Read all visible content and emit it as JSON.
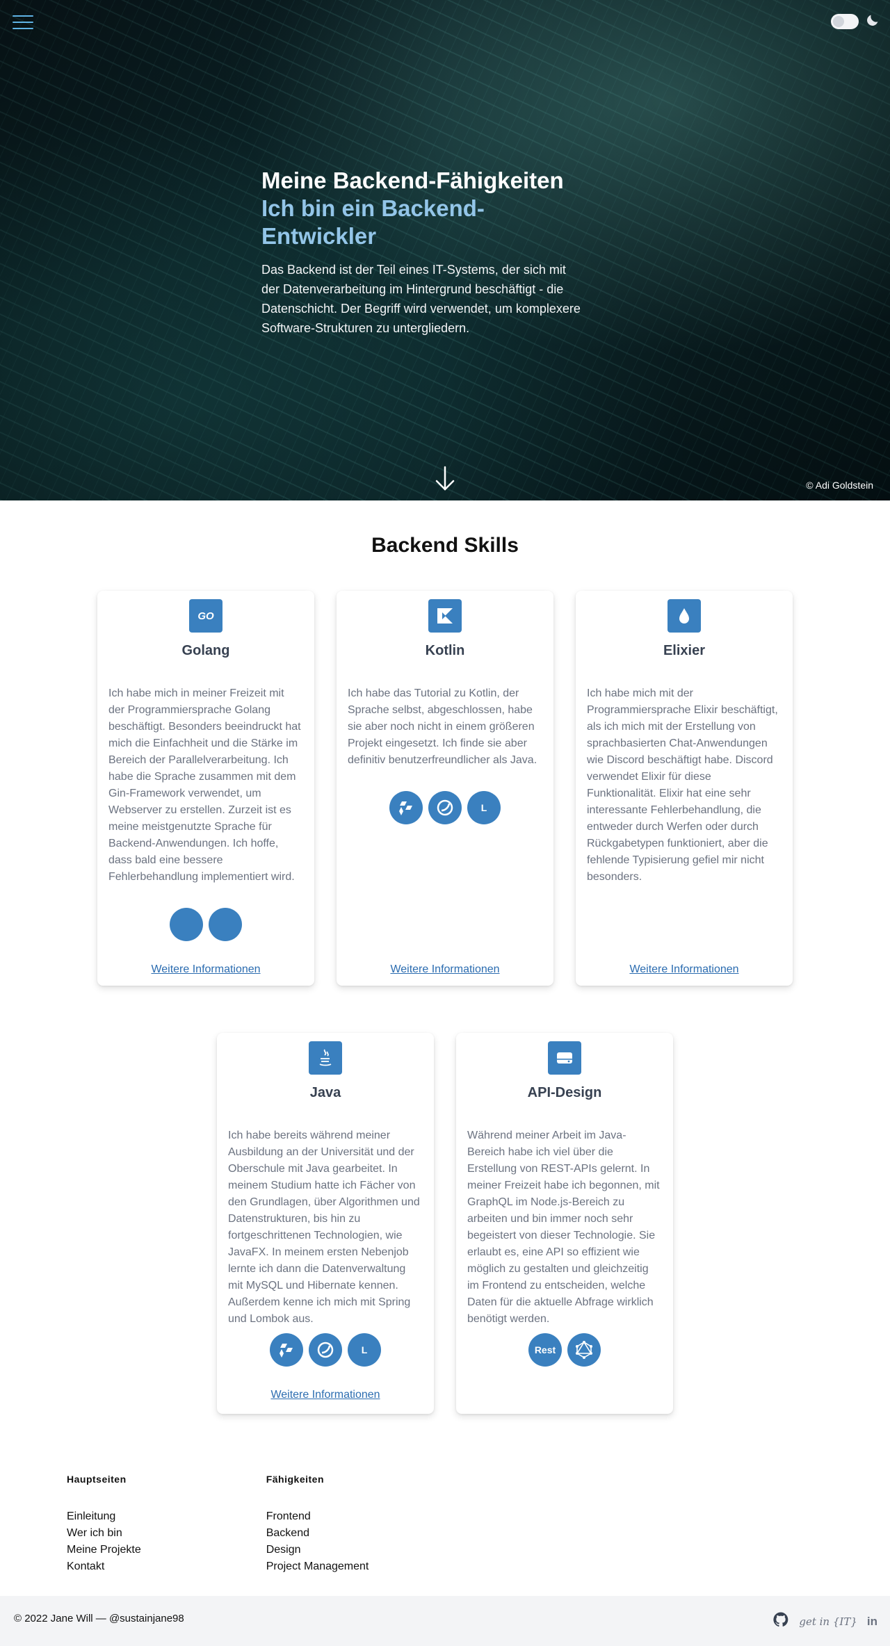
{
  "hero": {
    "title": "Meine Backend-Fähigkeiten",
    "subtitle": "Ich bin ein Backend-Entwickler",
    "description": "Das Backend ist der Teil eines IT-Systems, der sich mit der Datenverarbeitung im Hintergrund beschäftigt - die Datenschicht. Der Begriff wird verwendet, um komplexere Software-Strukturen zu untergliedern.",
    "credit": "© Adi Goldstein",
    "icons": {
      "menu": "menu-icon",
      "theme": "moon-icon",
      "scroll": "arrow-down-icon"
    }
  },
  "skills": {
    "title": "Backend Skills",
    "more_label": "Weitere Informationen",
    "cards": [
      {
        "name": "Golang",
        "icon": "golang-icon",
        "desc": "Ich habe mich in meiner Freizeit mit der Programmiersprache Golang beschäftigt. Besonders beeindruckt hat mich die Einfachheit und die Stärke im Bereich der Parallelverarbeitung. Ich habe die Sprache zusammen mit dem Gin-Framework verwendet, um Webserver zu erstellen. Zurzeit ist es meine meistgenutzte Sprache für Backend-Anwendungen. Ich hoffe, dass bald eine bessere Fehlerbehandlung implementiert wird.",
        "techs": [
          "",
          ""
        ]
      },
      {
        "name": "Kotlin",
        "icon": "kotlin-icon",
        "desc": "Ich habe das Tutorial zu Kotlin, der Sprache selbst, abgeschlossen, habe sie aber noch nicht in einem größeren Projekt eingesetzt. Ich finde sie aber definitiv benutzerfreundlicher als Java.",
        "techs": [
          "",
          "",
          "L"
        ]
      },
      {
        "name": "Elixier",
        "icon": "drop-icon",
        "desc": "Ich habe mich mit der Programmiersprache Elixir beschäftigt, als ich mich mit der Erstellung von sprachbasierten Chat-Anwendungen wie Discord beschäftigt habe. Discord verwendet Elixir für diese Funktionalität. Elixir hat eine sehr interessante Fehlerbehandlung, die entweder durch Werfen oder durch Rückgabetypen funktioniert, aber die fehlende Typisierung gefiel mir nicht besonders.",
        "techs": []
      },
      {
        "name": "Java",
        "icon": "java-icon",
        "desc": "Ich habe bereits während meiner Ausbildung an der Universität und der Oberschule mit Java gearbeitet. In meinem Studium hatte ich Fächer von den Grundlagen, über Algorithmen und Datenstrukturen, bis hin zu fortgeschrittenen Technologien, wie JavaFX. In meinem ersten Nebenjob lernte ich dann die Datenverwaltung mit MySQL und Hibernate kennen. Außerdem kenne ich mich mit Spring und Lombok aus.",
        "techs": [
          "",
          "",
          "L"
        ]
      },
      {
        "name": "API-Design",
        "icon": "server-icon",
        "desc": "Während meiner Arbeit im Java-Bereich habe ich viel über die Erstellung von REST-APIs gelernt. In meiner Freizeit habe ich begonnen, mit GraphQL im Node.js-Bereich zu arbeiten und bin immer noch sehr begeistert von dieser Technologie. Sie erlaubt es, eine API so effizient wie möglich zu gestalten und gleichzeitig im Frontend zu entscheiden, welche Daten für die aktuelle Abfrage wirklich benötigt werden.",
        "techs": [
          "Rest",
          ""
        ]
      }
    ]
  },
  "footer_links": {
    "col1": {
      "title": "Hauptseiten",
      "items": [
        "Einleitung",
        "Wer ich bin",
        "Meine Projekte",
        "Kontakt"
      ]
    },
    "col2": {
      "title": "Fähigkeiten",
      "items": [
        "Frontend",
        "Backend",
        "Design",
        "Project Management"
      ]
    }
  },
  "footer": {
    "copyright": "© 2022 Jane Will — @sustainjane98",
    "getin": "get in {IT}",
    "linkedin": "in",
    "icons": [
      "github-icon",
      "getin-it-icon",
      "linkedin-icon"
    ]
  },
  "colors": {
    "accent": "#3a80bf",
    "link": "#2b6cb0",
    "hero_sub": "#93c5e8"
  }
}
